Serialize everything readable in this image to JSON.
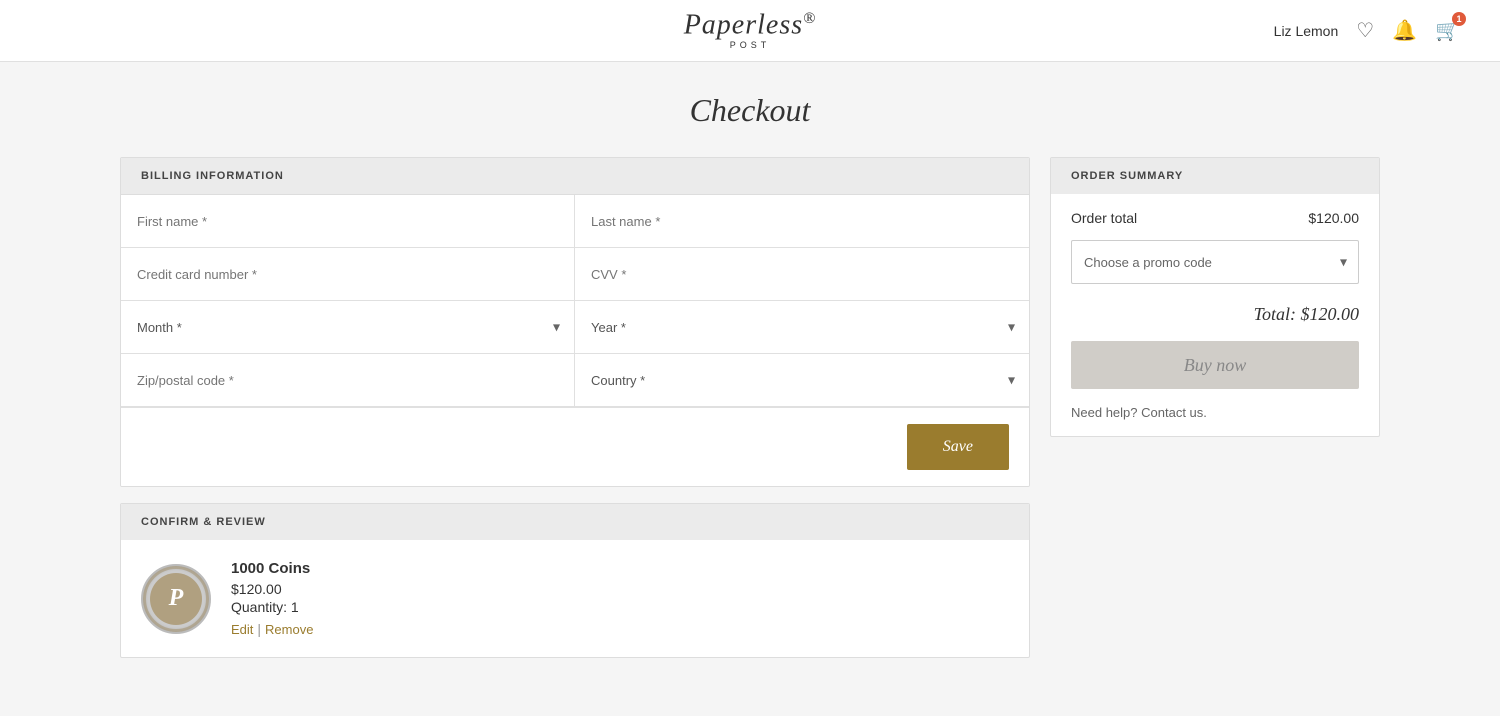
{
  "header": {
    "logo": "Paperless",
    "logo_reg": "®",
    "logo_sub": "POST",
    "username": "Liz Lemon",
    "cart_count": "1"
  },
  "page": {
    "title": "Checkout"
  },
  "billing": {
    "section_label": "BILLING INFORMATION",
    "first_name_placeholder": "First name *",
    "last_name_placeholder": "Last name *",
    "cc_number_placeholder": "Credit card number *",
    "cvv_placeholder": "CVV *",
    "month_placeholder": "Month *",
    "year_placeholder": "Year *",
    "zip_placeholder": "Zip/postal code *",
    "country_placeholder": "Country *",
    "save_label": "Save"
  },
  "review": {
    "section_label": "CONFIRM & REVIEW",
    "product_name": "1000 Coins",
    "product_price": "$120.00",
    "product_qty": "Quantity: 1",
    "edit_label": "Edit",
    "remove_label": "Remove",
    "product_img_letter": "P"
  },
  "order_summary": {
    "section_label": "ORDER SUMMARY",
    "order_total_label": "Order total",
    "order_total_value": "$120.00",
    "promo_placeholder": "Choose a promo code",
    "grand_total": "Total: $120.00",
    "buy_now_label": "Buy now",
    "help_text": "Need help?",
    "contact_text": "Contact us."
  }
}
